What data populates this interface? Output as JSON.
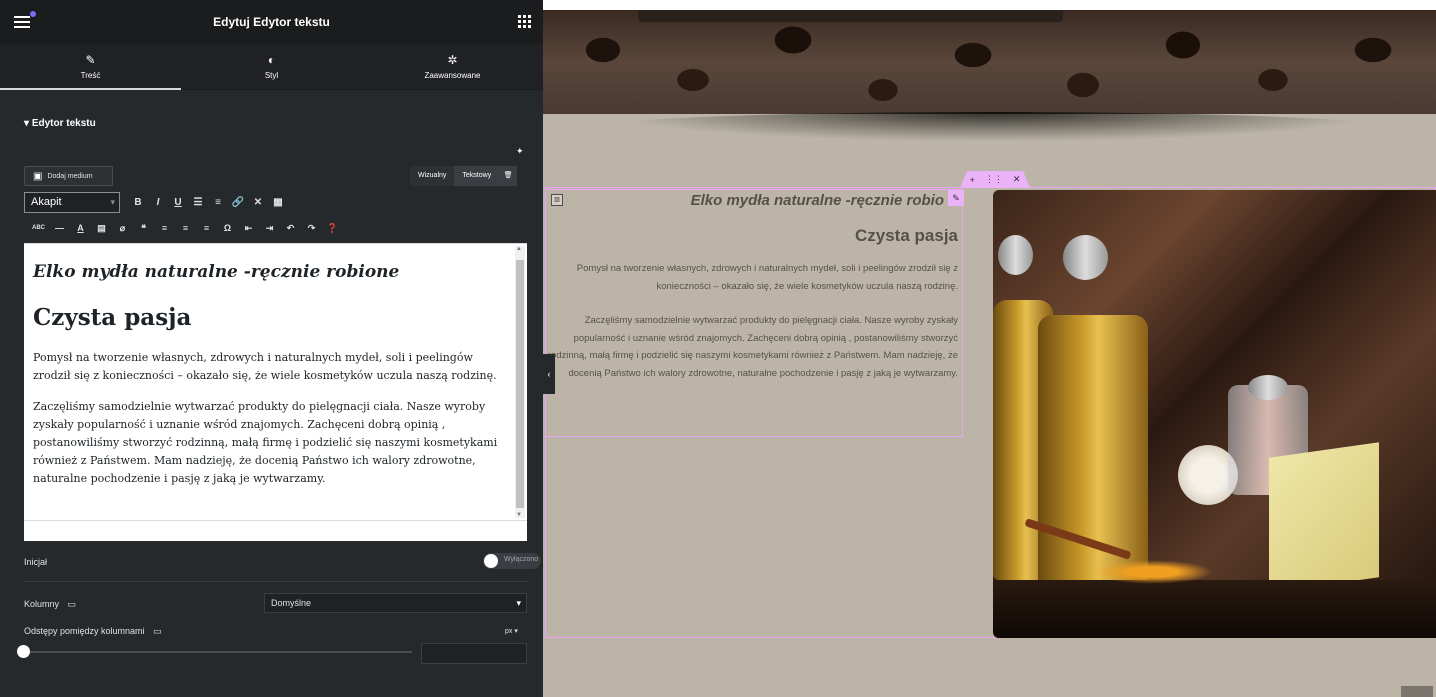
{
  "panel": {
    "title": "Edytuj Edytor tekstu",
    "tabs": [
      {
        "label": "Treść",
        "icon": "pencil-icon"
      },
      {
        "label": "Styl",
        "icon": "contrast-icon"
      },
      {
        "label": "Zaawansowane",
        "icon": "gear-icon"
      }
    ],
    "section_title": "Edytor tekstu",
    "add_media": "Dodaj medium",
    "mode_visual": "Wizualny",
    "mode_text": "Tekstowy",
    "format_select": "Akapit",
    "drop_cap_label": "Inicjał",
    "drop_cap_state": "Wyłączono",
    "columns_label": "Kolumny",
    "columns_value": "Domyślne",
    "gap_label": "Odstępy pomiędzy kolumnami",
    "gap_unit": "px"
  },
  "content": {
    "subtitle": "Elko mydła naturalne -ręcznie robione",
    "heading": "Czysta pasja",
    "p1": "Pomysł na tworzenie własnych, zdrowych i naturalnych mydeł, soli i peelingów zrodził się z konieczności – okazało się, że wiele kosmetyków uczula naszą rodzinę.",
    "p2": "Zaczęliśmy samodzielnie wytwarzać produkty do pielęgnacji ciała. Nasze wyroby zyskały popularność i uznanie wśród znajomych. Zachęceni dobrą opinią , postanowiliśmy stworzyć rodzinną, małą firmę i podzielić się naszymi kosmetykami również z Państwem. Mam nadzieję, że docenią Państwo ich walory zdrowotne, naturalne pochodzenie i pasję z jaką je wytwarzamy."
  },
  "preview": {
    "subtitle_visible": "Elko mydła naturalne -ręcznie robio"
  }
}
